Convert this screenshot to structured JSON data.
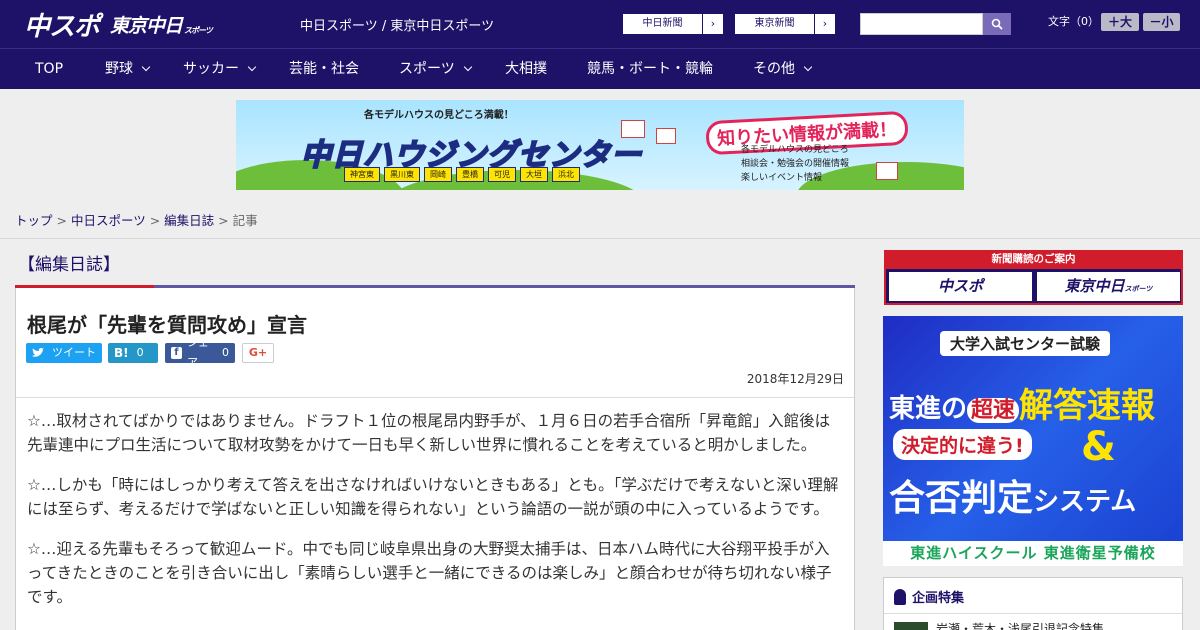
{
  "header": {
    "logo_chunichi": "中スポ",
    "logo_tokyo": "東京中日",
    "logo_tokyo_sub": "スポーツ",
    "site_name": "中日スポーツ / 東京中日スポーツ",
    "paper_links": [
      "中日新聞",
      "東京新聞"
    ],
    "font_label": "文字（0）",
    "font_plus": "＋大",
    "font_minus": "－小"
  },
  "nav": {
    "items": [
      "TOP",
      "野球",
      "サッカー",
      "芸能・社会",
      "スポーツ",
      "大相撲",
      "競馬・ボート・競輪",
      "その他"
    ]
  },
  "banner": {
    "tagline": "各モデルハウスの見どころ満載！",
    "brand": "中日ハウジングセンター",
    "headline": "知りたい情報が満載！",
    "cities": [
      "神宮東",
      "黒川東",
      "岡崎",
      "豊橋",
      "可児",
      "大垣",
      "浜北"
    ],
    "bullets": [
      "各モデルハウスの見どころ",
      "相談会・勉強会の開催情報",
      "楽しいイベント情報"
    ]
  },
  "breadcrumb": {
    "items": [
      "トップ",
      "中日スポーツ",
      "編集日誌",
      "記事"
    ]
  },
  "article": {
    "category": "【編集日誌】",
    "title": "根尾が「先輩を質問攻め」宣言",
    "share": {
      "tweet": "ツイート",
      "hatena": "B!",
      "hatena_count": "0",
      "facebook": "シェア",
      "facebook_count": "0",
      "gplus": "G+"
    },
    "date": "2018年12月29日",
    "paragraphs": [
      "☆…取材されてばかりではありません。ドラフト１位の根尾昂内野手が、１月６日の若手合宿所「昇竜館」入館後は先輩連中にプロ生活について取材攻勢をかけて一日も早く新しい世界に慣れることを考えていると明かしました。",
      "☆…しかも「時にはしっかり考えて答えを出さなければいけないときもある」とも。「学ぶだけで考えないと深い理解には至らず、考えるだけで学ばないと正しい知識を得られない」という論語の一説が頭の中に入っているようです。",
      "☆…迎える先輩もそろって歓迎ムード。中でも同じ岐阜県出身の大野奨太捕手は、日本ハム時代に大谷翔平投手が入ってきたときのことを引き合いに出し「素晴らしい選手と一緒にできるのは楽しみ」と顔合わせが待ち切れない様子です。"
    ]
  },
  "sidebar": {
    "subscribe_title": "新聞購読のご案内",
    "paper1": "中スポ",
    "paper2": "東京中日",
    "paper2_sub": "スポーツ",
    "ad": {
      "top": "大学入試センター試験",
      "line2a": "東進の",
      "line2b": "超速",
      "line2c": "解答速報",
      "line3": "決定的に違う!",
      "amp": "&",
      "line4a": "合否判定",
      "line4b": "システム",
      "footer": "東進ハイスクール 東進衛星予備校"
    },
    "feature_title": "企画特集",
    "feature_item": "岩瀬・荒木・浅尾引退記念特集"
  }
}
